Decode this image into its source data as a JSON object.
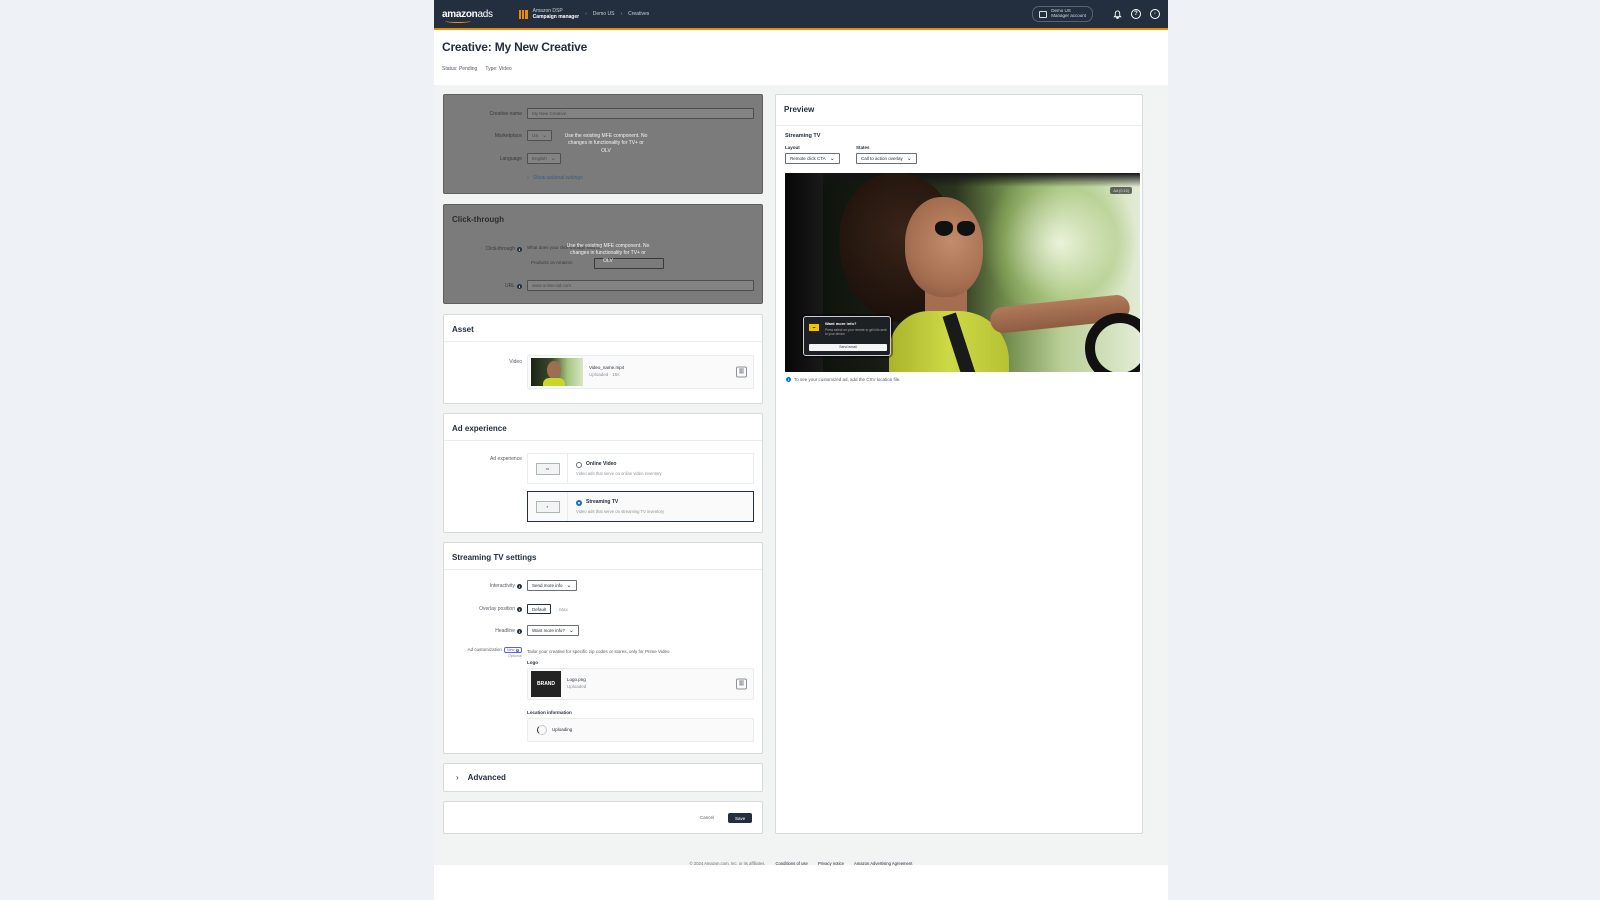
{
  "topbar": {
    "logo": "amazon",
    "logo_suffix": "ads",
    "product_top": "Amazon DSP",
    "product_main": "Campaign manager",
    "crumb_1": "Demo US",
    "crumb_2": "Creatives",
    "account_line1": "Demo US",
    "account_line2": "Manager account",
    "icons": [
      "bell-icon",
      "help-icon",
      "settings-icon"
    ]
  },
  "header": {
    "title": "Creative:  My New Creative",
    "status": "Status: Pending",
    "type": "Type: Video"
  },
  "general": {
    "creative_name_label": "Creative name",
    "creative_name_value": "My New Creative",
    "marketplace_label": "Marketplace",
    "marketplace_value": "US",
    "language_label": "Language",
    "language_value": "English",
    "note": "Use the existing MFE component. No changes in functionality for TV+ or OLV",
    "optional_settings": "Show optional settings"
  },
  "clickthrough": {
    "heading": "Click-through",
    "clickthrough_label": "Click-through",
    "clickthrough_question": "What does your click-through lead to?",
    "clickthrough_option": "Products on Amazon",
    "note": "Use the existing MFE component. No changes in functionality for TV+ or OLV",
    "url_label": "URL",
    "url_placeholder": "www.online-ad.com"
  },
  "asset": {
    "heading": "Asset",
    "video_label": "Video",
    "file_name": "Video_name.mp4",
    "file_meta": "Uploaded   ·   15s"
  },
  "ad_experience": {
    "heading": "Ad experience",
    "label": "Ad experience",
    "options": [
      {
        "title": "Online Video",
        "desc": "Video ads that serve on online video inventory",
        "selected": false
      },
      {
        "title": "Streaming TV",
        "desc": "Video ads that serve on streaming TV inventory",
        "selected": true
      }
    ]
  },
  "streaming_settings": {
    "heading": "Streaming TV settings",
    "interactivity_label": "Interactivity",
    "interactivity_value": "Send more info",
    "overlay_label": "Overlay position",
    "overlay_options": [
      "Default",
      "Max"
    ],
    "headline_label": "Headline",
    "headline_value": "Want more info?",
    "ad_customization_label": "Ad customization",
    "new_badge": "New",
    "optional": "Optional",
    "customization_desc": "Tailor your creative for specific zip codes or stores, only for Prime Video",
    "logo_label": "Logo",
    "logo_thumb_text": "BRAND",
    "logo_file": "Logo.png",
    "logo_meta": "Uploaded",
    "location_label": "Location information",
    "uploading": "Uploading"
  },
  "advanced": {
    "label": "Advanced"
  },
  "actions": {
    "cancel": "Cancel",
    "save": "Save"
  },
  "preview": {
    "heading": "Preview",
    "sub_heading": "Streaming TV",
    "layout_label": "Layout",
    "layout_value": "Remote click CTA",
    "states_label": "States",
    "states_value": "Call to action overlay",
    "ad_badge": "Ad (0:15)",
    "cta_title": "Want more info?",
    "cta_body": "Press select on your remote to get info sent to your device",
    "cta_button": "Send email",
    "footnote": "To see your customized ad, add the CSV location file."
  },
  "footer": {
    "copyright": "© 2024 Amazon.com, Inc. or its affiliates.",
    "links": [
      "Conditions of use",
      "Privacy notice",
      "Amazon Advertising Agreement"
    ]
  },
  "colors": {
    "topbar": "#232f3e",
    "accent": "#f08a00",
    "primary_button": "#232f3e",
    "selected_radio": "#0972d3",
    "disabled_card": "#7b7b7b"
  }
}
